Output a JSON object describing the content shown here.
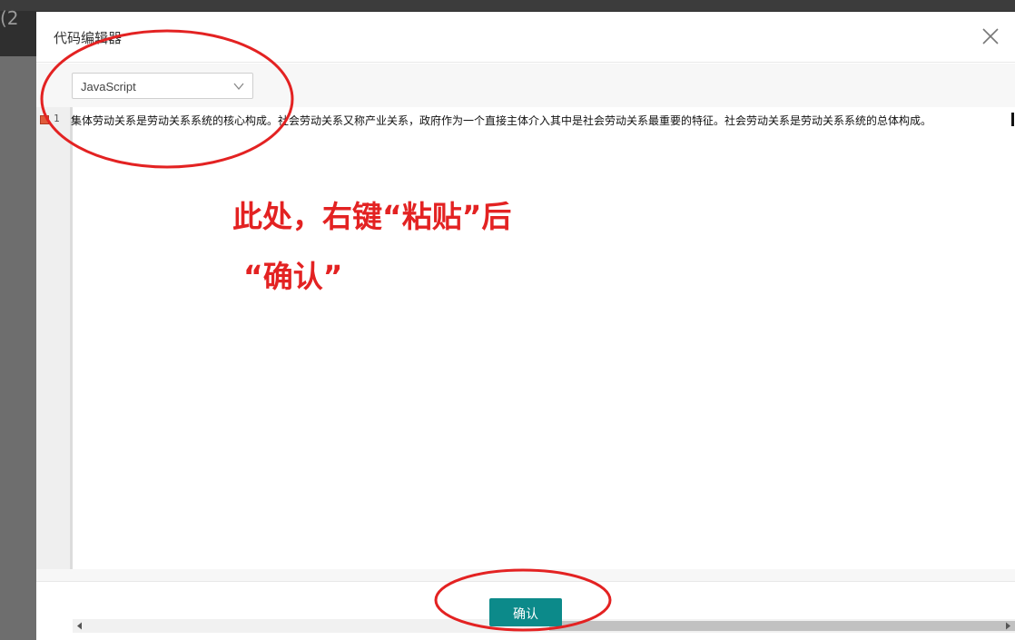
{
  "background": {
    "crumb_text": "(2"
  },
  "modal": {
    "title": "代码编辑器",
    "close_icon": "close-icon"
  },
  "editor": {
    "language_selected": "JavaScript",
    "line_number": "1",
    "line_text": "集体劳动关系是劳动关系系统的核心构成。社会劳动关系又称产业关系，政府作为一个直接主体介入其中是社会劳动关系最重要的特征。社会劳动关系是劳动关系系统的总体构成。"
  },
  "footer": {
    "confirm_label": "确认"
  },
  "annotation": {
    "line1": "此处，右键“粘贴”后",
    "line2": "“确认”",
    "color": "#e32222"
  },
  "colors": {
    "accent": "#0c8a8a",
    "marker": "#e05a3a"
  }
}
